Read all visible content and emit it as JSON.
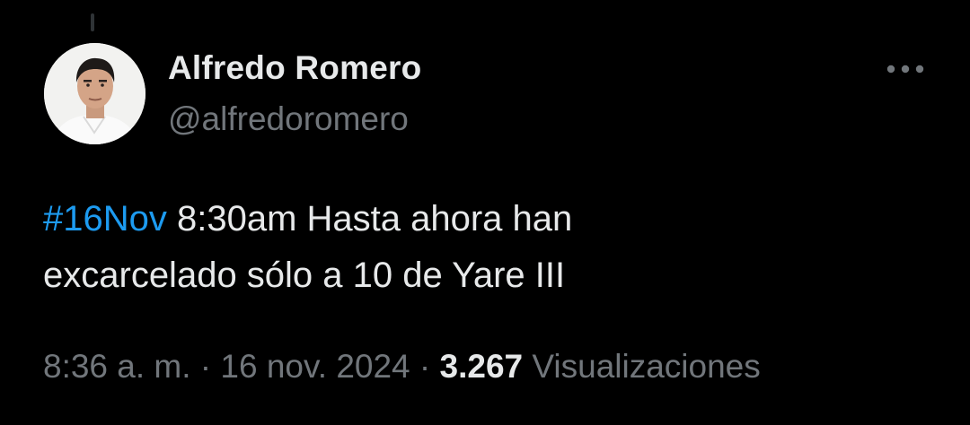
{
  "tweet": {
    "author": {
      "display_name": "Alfredo Romero",
      "handle": "@alfredoromero",
      "avatar_icon": "profile-photo"
    },
    "more_icon": "more-horizontal-icon",
    "text": {
      "hashtag": "#16Nov",
      "body_line1": " 8:30am Hasta ahora han",
      "body_line2": "excarcelado sólo a 10 de Yare III"
    },
    "meta": {
      "time": "8:36 a. m.",
      "separator1": " · ",
      "date": "16 nov. 2024",
      "separator2": " · ",
      "views_count": "3.267",
      "views_label": " Visualizaciones"
    },
    "colors": {
      "background": "#000000",
      "text": "#e7e9ea",
      "secondary": "#71767b",
      "link": "#1d9bf0"
    }
  }
}
